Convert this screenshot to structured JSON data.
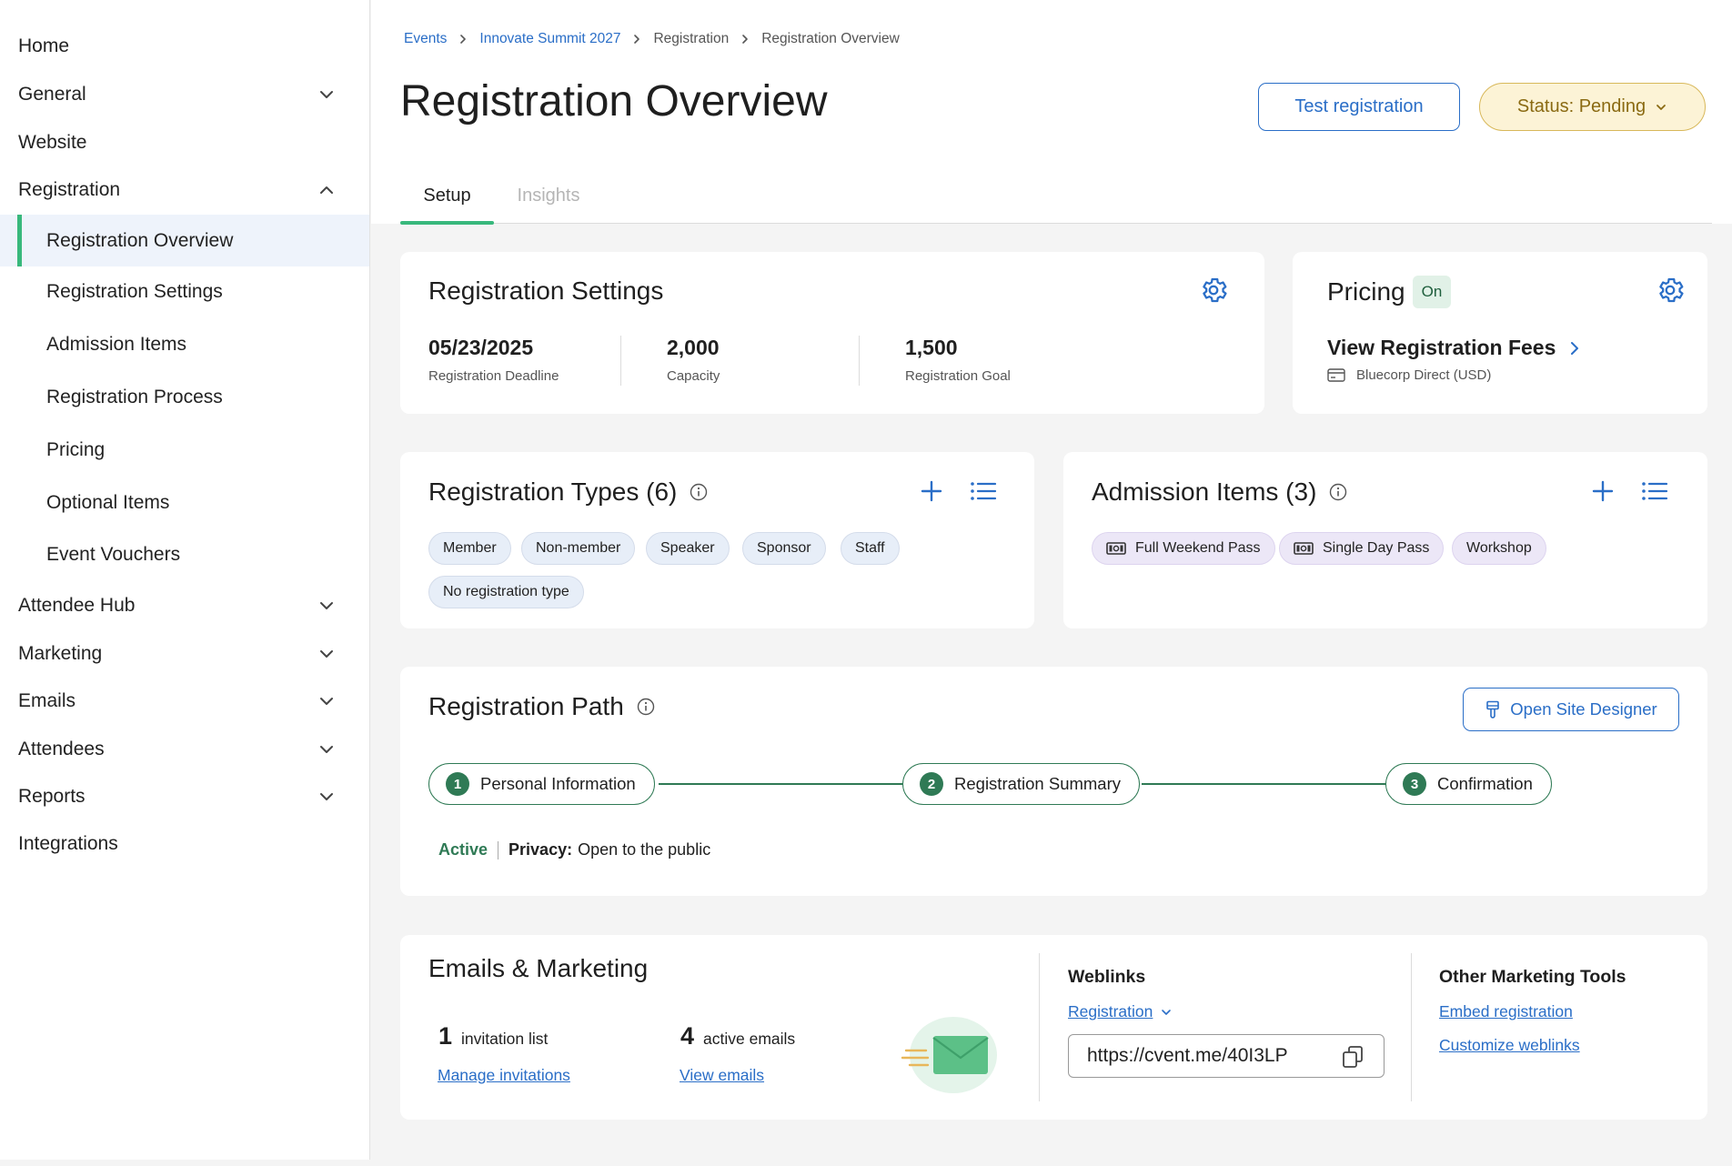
{
  "sidebar": {
    "items": [
      {
        "label": "Home"
      },
      {
        "label": "General"
      },
      {
        "label": "Website"
      },
      {
        "label": "Registration"
      },
      {
        "label": "Registration Overview"
      },
      {
        "label": "Registration Settings"
      },
      {
        "label": "Admission Items"
      },
      {
        "label": "Registration Process"
      },
      {
        "label": "Pricing"
      },
      {
        "label": "Optional Items"
      },
      {
        "label": "Event Vouchers"
      },
      {
        "label": "Attendee Hub"
      },
      {
        "label": "Marketing"
      },
      {
        "label": "Emails"
      },
      {
        "label": "Attendees"
      },
      {
        "label": "Reports"
      },
      {
        "label": "Integrations"
      }
    ]
  },
  "breadcrumb": [
    "Events",
    "Innovate Summit 2027",
    "Registration",
    "Registration Overview"
  ],
  "header": {
    "title": "Registration Overview",
    "test_button": "Test registration",
    "status_button": "Status: Pending"
  },
  "tabs": [
    {
      "label": "Setup"
    },
    {
      "label": "Insights"
    }
  ],
  "registration_settings": {
    "title": "Registration Settings",
    "stats": [
      {
        "value": "05/23/2025",
        "label": "Registration Deadline"
      },
      {
        "value": "2,000",
        "label": "Capacity"
      },
      {
        "value": "1,500",
        "label": "Registration Goal"
      }
    ]
  },
  "pricing": {
    "title": "Pricing",
    "badge": "On",
    "link": "View Registration Fees",
    "merchant": "Bluecorp Direct (USD)"
  },
  "registration_types": {
    "title": "Registration Types (6)",
    "chips": [
      "Member",
      "Non-member",
      "Speaker",
      "Sponsor",
      "Staff",
      "No registration type"
    ]
  },
  "admission_items": {
    "title": "Admission Items (3)",
    "chips": [
      "Full Weekend Pass",
      "Single Day Pass",
      "Workshop"
    ]
  },
  "registration_path": {
    "title": "Registration Path",
    "button": "Open Site Designer",
    "steps": [
      {
        "num": "1",
        "label": "Personal Information"
      },
      {
        "num": "2",
        "label": "Registration Summary"
      },
      {
        "num": "3",
        "label": "Confirmation"
      }
    ],
    "status": "Active",
    "privacy_label": "Privacy:",
    "privacy_value": "Open to the public"
  },
  "emails_marketing": {
    "title": "Emails & Marketing",
    "invitation_count": "1",
    "invitation_label": "invitation list",
    "invitation_link": "Manage invitations",
    "emails_count": "4",
    "emails_label": "active emails",
    "emails_link": "View emails",
    "weblinks_title": "Weblinks",
    "weblinks_select": "Registration",
    "weblink_url": "https://cvent.me/40I3LP",
    "other_tools_title": "Other Marketing Tools",
    "other_tools_links": [
      "Embed registration",
      "Customize weblinks"
    ]
  },
  "colors": {
    "accent_blue": "#2a6ec7",
    "accent_green": "#38b87c",
    "path_green": "#2f7a55",
    "status_yellow": "#fcf3d6"
  }
}
